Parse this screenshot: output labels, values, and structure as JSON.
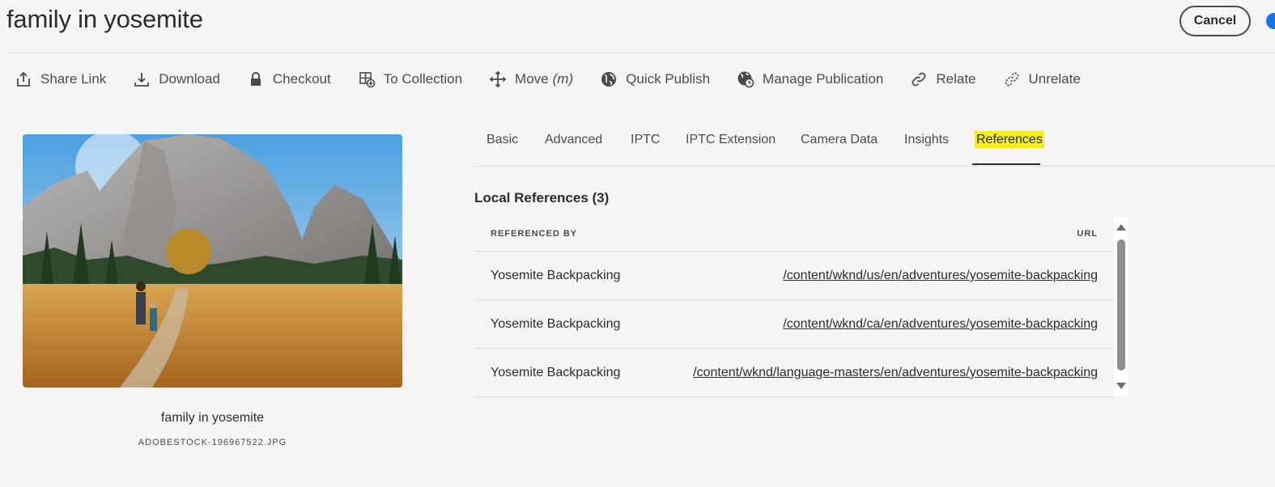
{
  "header": {
    "title": "family in yosemite",
    "cancel_label": "Cancel"
  },
  "toolbar": {
    "items": [
      {
        "label": "Share Link",
        "icon": "share-icon"
      },
      {
        "label": "Download",
        "icon": "download-icon"
      },
      {
        "label": "Checkout",
        "icon": "lock-icon"
      },
      {
        "label": "To Collection",
        "icon": "add-to-collection-icon"
      },
      {
        "label": "Move",
        "shortcut": "(m)",
        "icon": "move-icon"
      },
      {
        "label": "Quick Publish",
        "icon": "globe-icon"
      },
      {
        "label": "Manage Publication",
        "icon": "globe-clock-icon"
      },
      {
        "label": "Relate",
        "icon": "link-icon"
      },
      {
        "label": "Unrelate",
        "icon": "unlink-icon"
      }
    ]
  },
  "asset": {
    "name": "family in yosemite",
    "filename": "ADOBESTOCK-196967522.JPG"
  },
  "tabs": [
    {
      "label": "Basic"
    },
    {
      "label": "Advanced"
    },
    {
      "label": "IPTC"
    },
    {
      "label": "IPTC Extension"
    },
    {
      "label": "Camera Data"
    },
    {
      "label": "Insights"
    },
    {
      "label": "References",
      "active": true
    }
  ],
  "references": {
    "title": "Local References (3)",
    "columns": [
      "REFERENCED BY",
      "URL"
    ],
    "rows": [
      {
        "referenced_by": "Yosemite Backpacking",
        "url": "/content/wknd/us/en/adventures/yosemite-backpacking"
      },
      {
        "referenced_by": "Yosemite Backpacking",
        "url": "/content/wknd/ca/en/adventures/yosemite-backpacking"
      },
      {
        "referenced_by": "Yosemite Backpacking",
        "url": "/content/wknd/language-masters/en/adventures/yosemite-backpacking"
      }
    ]
  },
  "colors": {
    "highlight": "#f6ee1b",
    "text": "#2c2c2c",
    "background": "#f5f5f5"
  }
}
